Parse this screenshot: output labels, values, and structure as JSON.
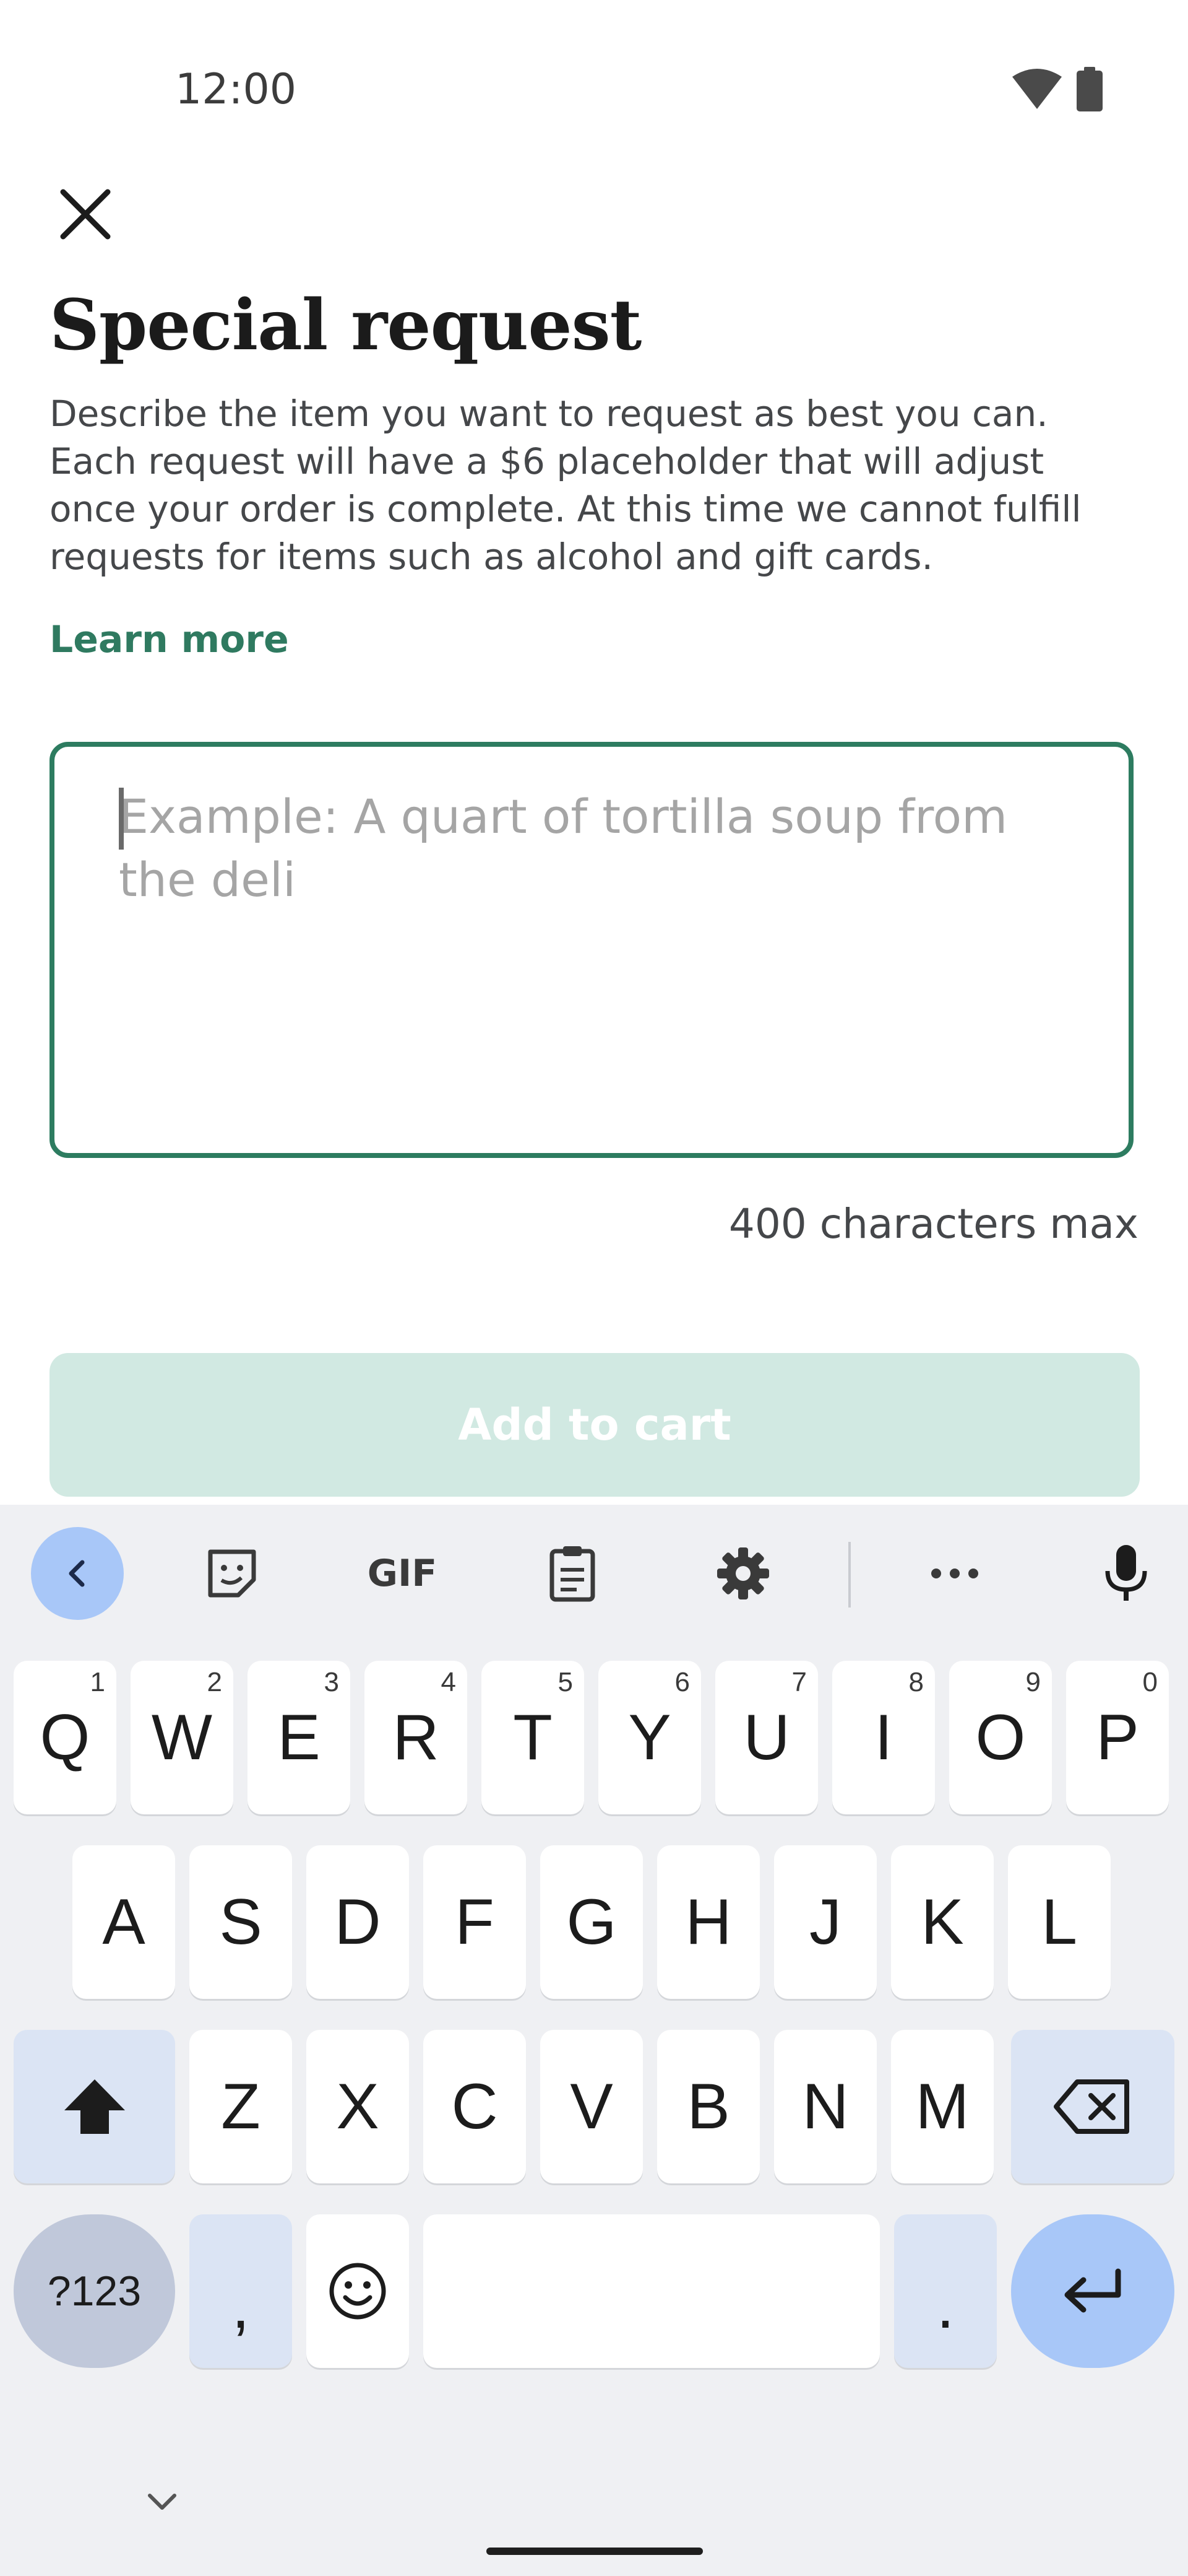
{
  "status_bar": {
    "time": "12:00"
  },
  "screen": {
    "title": "Special request",
    "description": "Describe the item you want to request as best you can. Each request will have a $6 placeholder that will adjust once your order is complete. At this time we cannot fulfill requests for items such as alcohol and gift cards.",
    "learn_more": "Learn more",
    "request_input": {
      "value": "",
      "placeholder": "Example: A quart of tortilla soup from the deli"
    },
    "char_limit": "400 characters max",
    "add_to_cart": "Add to cart"
  },
  "colors": {
    "accent": "#2d7c60",
    "button_disabled": "#d1e9e2",
    "keyboard_bg": "#eff0f3",
    "key_accent": "#a8c7f8"
  },
  "keyboard": {
    "toolbar": {
      "gif_label": "GIF",
      "icons": [
        "chevron-left-icon",
        "sticker-icon",
        "gif-icon",
        "clipboard-icon",
        "gear-icon",
        "more-icon",
        "microphone-icon"
      ]
    },
    "row1": [
      {
        "key": "Q",
        "hint": "1"
      },
      {
        "key": "W",
        "hint": "2"
      },
      {
        "key": "E",
        "hint": "3"
      },
      {
        "key": "R",
        "hint": "4"
      },
      {
        "key": "T",
        "hint": "5"
      },
      {
        "key": "Y",
        "hint": "6"
      },
      {
        "key": "U",
        "hint": "7"
      },
      {
        "key": "I",
        "hint": "8"
      },
      {
        "key": "O",
        "hint": "9"
      },
      {
        "key": "P",
        "hint": "0"
      }
    ],
    "row2": [
      "A",
      "S",
      "D",
      "F",
      "G",
      "H",
      "J",
      "K",
      "L"
    ],
    "row3": [
      "Z",
      "X",
      "C",
      "V",
      "B",
      "N",
      "M"
    ],
    "symbols_label": "?123",
    "comma": ",",
    "period": "."
  }
}
